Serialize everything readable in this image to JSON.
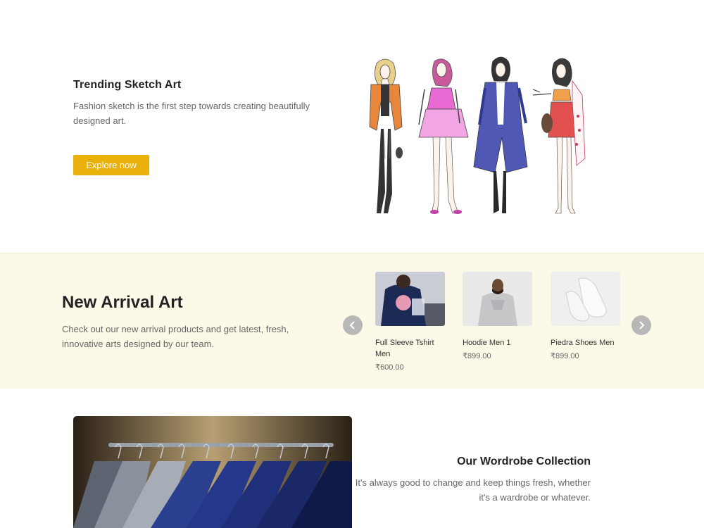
{
  "hero": {
    "title": "Trending Sketch Art",
    "description": "Fashion sketch is the first step towards creating beautifully designed art.",
    "button_label": "Explore now",
    "accent_color": "#e9b10a"
  },
  "arrival": {
    "title": "New Arrival Art",
    "description": "Check out our new arrival products and get latest, fresh, innovative arts designed by our team.",
    "prev_icon": "chevron-left-icon",
    "next_icon": "chevron-right-icon",
    "background": "#fdf9e8",
    "products": [
      {
        "name": "Full Sleeve Tshirt Men",
        "price": "₹600.00"
      },
      {
        "name": "Hoodie Men 1",
        "price": "₹899.00"
      },
      {
        "name": "Piedra Shoes Men",
        "price": "₹899.00"
      }
    ]
  },
  "wardrobe": {
    "title": "Our Wordrobe Collection",
    "description": "It's always good to change and keep things fresh, whether it's a wardrobe or whatever."
  }
}
